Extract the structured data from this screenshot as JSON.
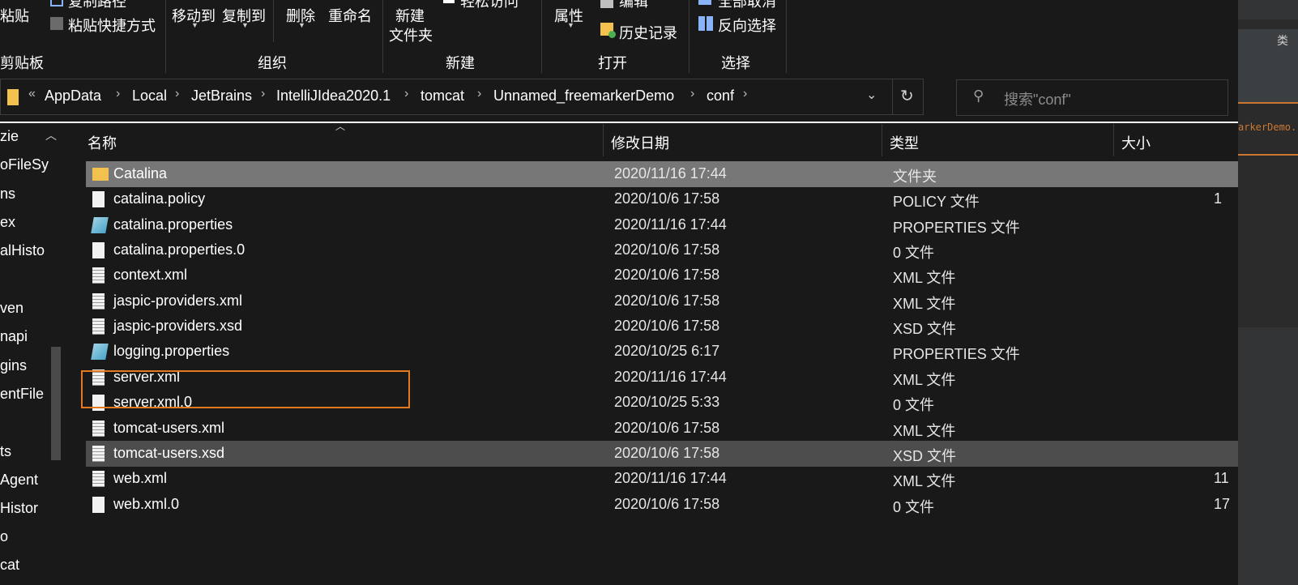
{
  "ribbon": {
    "paste": "粘贴",
    "copy_path": "复制路径",
    "paste_shortcut": "粘贴快捷方式",
    "move_to": "移动到",
    "copy_to": "复制到",
    "delete": "删除",
    "rename": "重命名",
    "new_folder_line1": "新建",
    "new_folder_line2": "文件夹",
    "easy_access": "轻松访问",
    "properties": "属性",
    "edit": "编辑",
    "history": "历史记录",
    "select_none": "全部取消",
    "invert_selection": "反向选择",
    "groups": {
      "clipboard": "剪贴板",
      "organize": "组织",
      "new": "新建",
      "open": "打开",
      "select": "选择"
    }
  },
  "address": {
    "overflow": "«",
    "crumbs": [
      "AppData",
      "Local",
      "JetBrains",
      "IntelliJIdea2020.1",
      "tomcat",
      "Unnamed_freemarkerDemo",
      "conf"
    ],
    "refresh_icon": "refresh-icon",
    "search_placeholder": "搜索\"conf\""
  },
  "nav": {
    "items": [
      "zie",
      "oFileSy",
      "ns",
      "ex",
      "alHisto",
      "",
      "ven",
      "napi",
      "gins",
      "entFile",
      "",
      "ts",
      "Agent",
      "Histor",
      "o",
      "cat"
    ]
  },
  "columns": {
    "name": "名称",
    "date": "修改日期",
    "type": "类型",
    "size": "大小"
  },
  "files": [
    {
      "name": "Catalina",
      "date": "2020/11/16 17:44",
      "type": "文件夹",
      "size": "",
      "icon": "folder-icon",
      "state": "selected"
    },
    {
      "name": "catalina.policy",
      "date": "2020/10/6 17:58",
      "type": "POLICY 文件",
      "size": "1",
      "icon": "blank-file-icon",
      "state": ""
    },
    {
      "name": "catalina.properties",
      "date": "2020/11/16 17:44",
      "type": "PROPERTIES 文件",
      "size": "",
      "icon": "properties-file-icon",
      "state": ""
    },
    {
      "name": "catalina.properties.0",
      "date": "2020/10/6 17:58",
      "type": "0 文件",
      "size": "",
      "icon": "blank-file-icon",
      "state": ""
    },
    {
      "name": "context.xml",
      "date": "2020/10/6 17:58",
      "type": "XML 文件",
      "size": "",
      "icon": "text-file-icon",
      "state": ""
    },
    {
      "name": "jaspic-providers.xml",
      "date": "2020/10/6 17:58",
      "type": "XML 文件",
      "size": "",
      "icon": "text-file-icon",
      "state": ""
    },
    {
      "name": "jaspic-providers.xsd",
      "date": "2020/10/6 17:58",
      "type": "XSD 文件",
      "size": "",
      "icon": "text-file-icon",
      "state": ""
    },
    {
      "name": "logging.properties",
      "date": "2020/10/25 6:17",
      "type": "PROPERTIES 文件",
      "size": "",
      "icon": "properties-file-icon",
      "state": ""
    },
    {
      "name": "server.xml",
      "date": "2020/11/16 17:44",
      "type": "XML 文件",
      "size": "",
      "icon": "text-file-icon",
      "state": ""
    },
    {
      "name": "server.xml.0",
      "date": "2020/10/25 5:33",
      "type": "0 文件",
      "size": "",
      "icon": "blank-file-icon",
      "state": ""
    },
    {
      "name": "tomcat-users.xml",
      "date": "2020/10/6 17:58",
      "type": "XML 文件",
      "size": "",
      "icon": "text-file-icon",
      "state": ""
    },
    {
      "name": "tomcat-users.xsd",
      "date": "2020/10/6 17:58",
      "type": "XSD 文件",
      "size": "",
      "icon": "text-file-icon",
      "state": "hover"
    },
    {
      "name": "web.xml",
      "date": "2020/11/16 17:44",
      "type": "XML 文件",
      "size": "11",
      "icon": "text-file-icon",
      "state": ""
    },
    {
      "name": "web.xml.0",
      "date": "2020/10/6 17:58",
      "type": "0 文件",
      "size": "17",
      "icon": "blank-file-icon",
      "state": ""
    }
  ],
  "ide": {
    "tab_label": "类",
    "code_fragment": "arkerDemo."
  },
  "colors": {
    "background": "#191919",
    "selected_row": "#777777",
    "hover_row": "#4d4d4d",
    "highlight_box": "#e37a1f",
    "folder": "#f2c14e"
  }
}
